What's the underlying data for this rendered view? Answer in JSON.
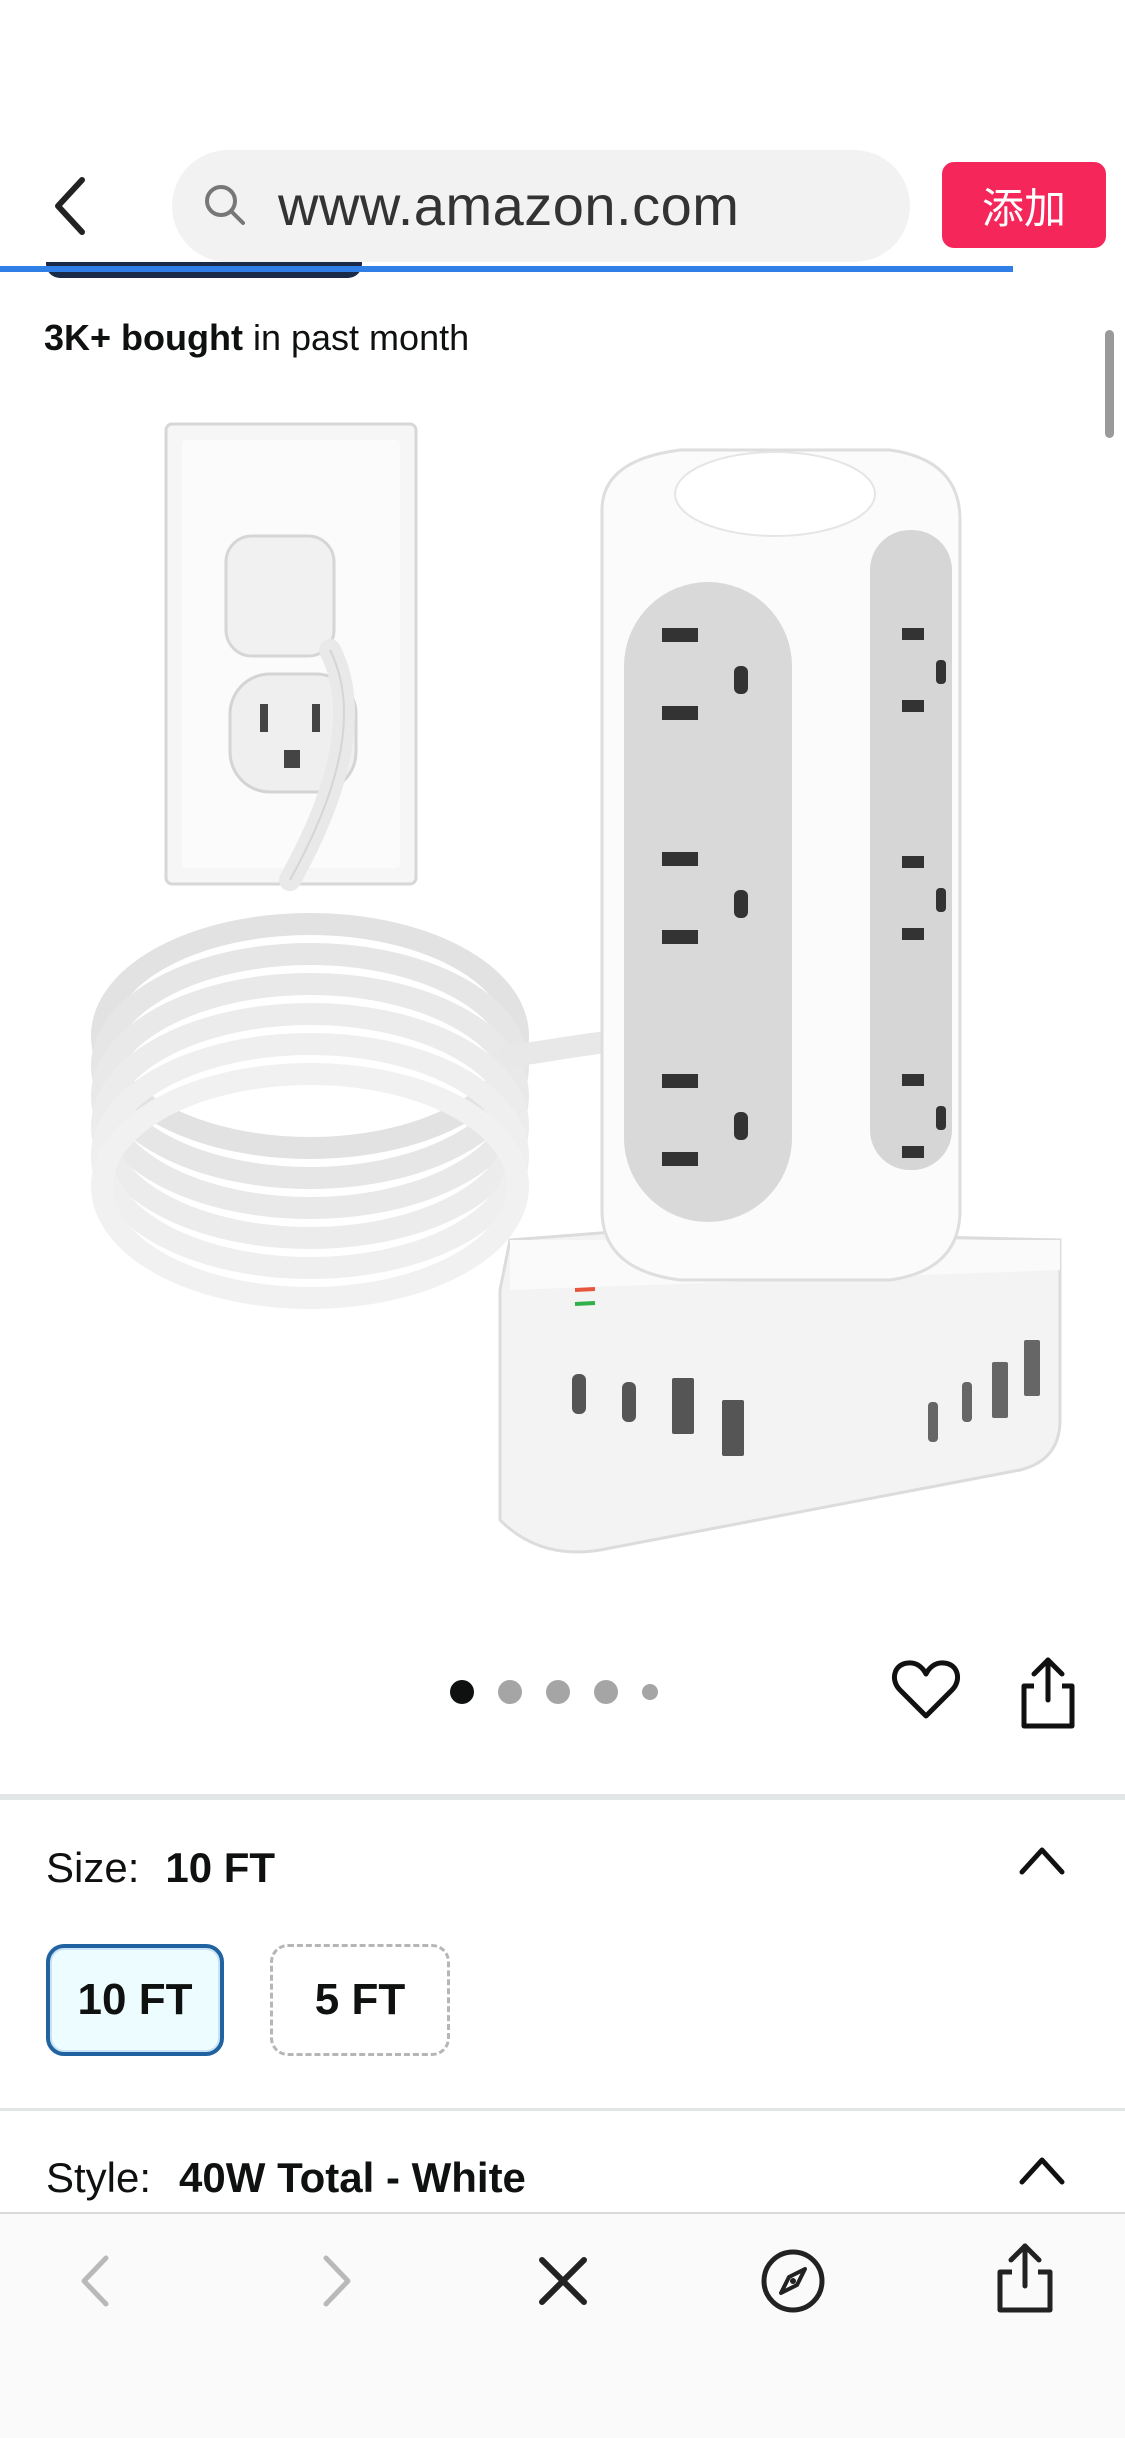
{
  "browser": {
    "url": "www.amazon.com",
    "add_button_label": "添加",
    "accent_color": "#f5275a",
    "progress_color": "#2f7fe6"
  },
  "product": {
    "bought_strong": "3K+ bought",
    "bought_rest": " in past month",
    "image_icon": "power-strip-tower-image",
    "carousel": {
      "count": 5,
      "active_index": 0
    }
  },
  "size": {
    "label": "Size:",
    "selected": "10 FT",
    "options": [
      "10 FT",
      "5 FT"
    ]
  },
  "style": {
    "label": "Style:",
    "selected": "40W Total - White"
  },
  "bottom_nav": {
    "icons": [
      "back-icon",
      "forward-icon",
      "close-icon",
      "compass-icon",
      "share-icon"
    ]
  }
}
